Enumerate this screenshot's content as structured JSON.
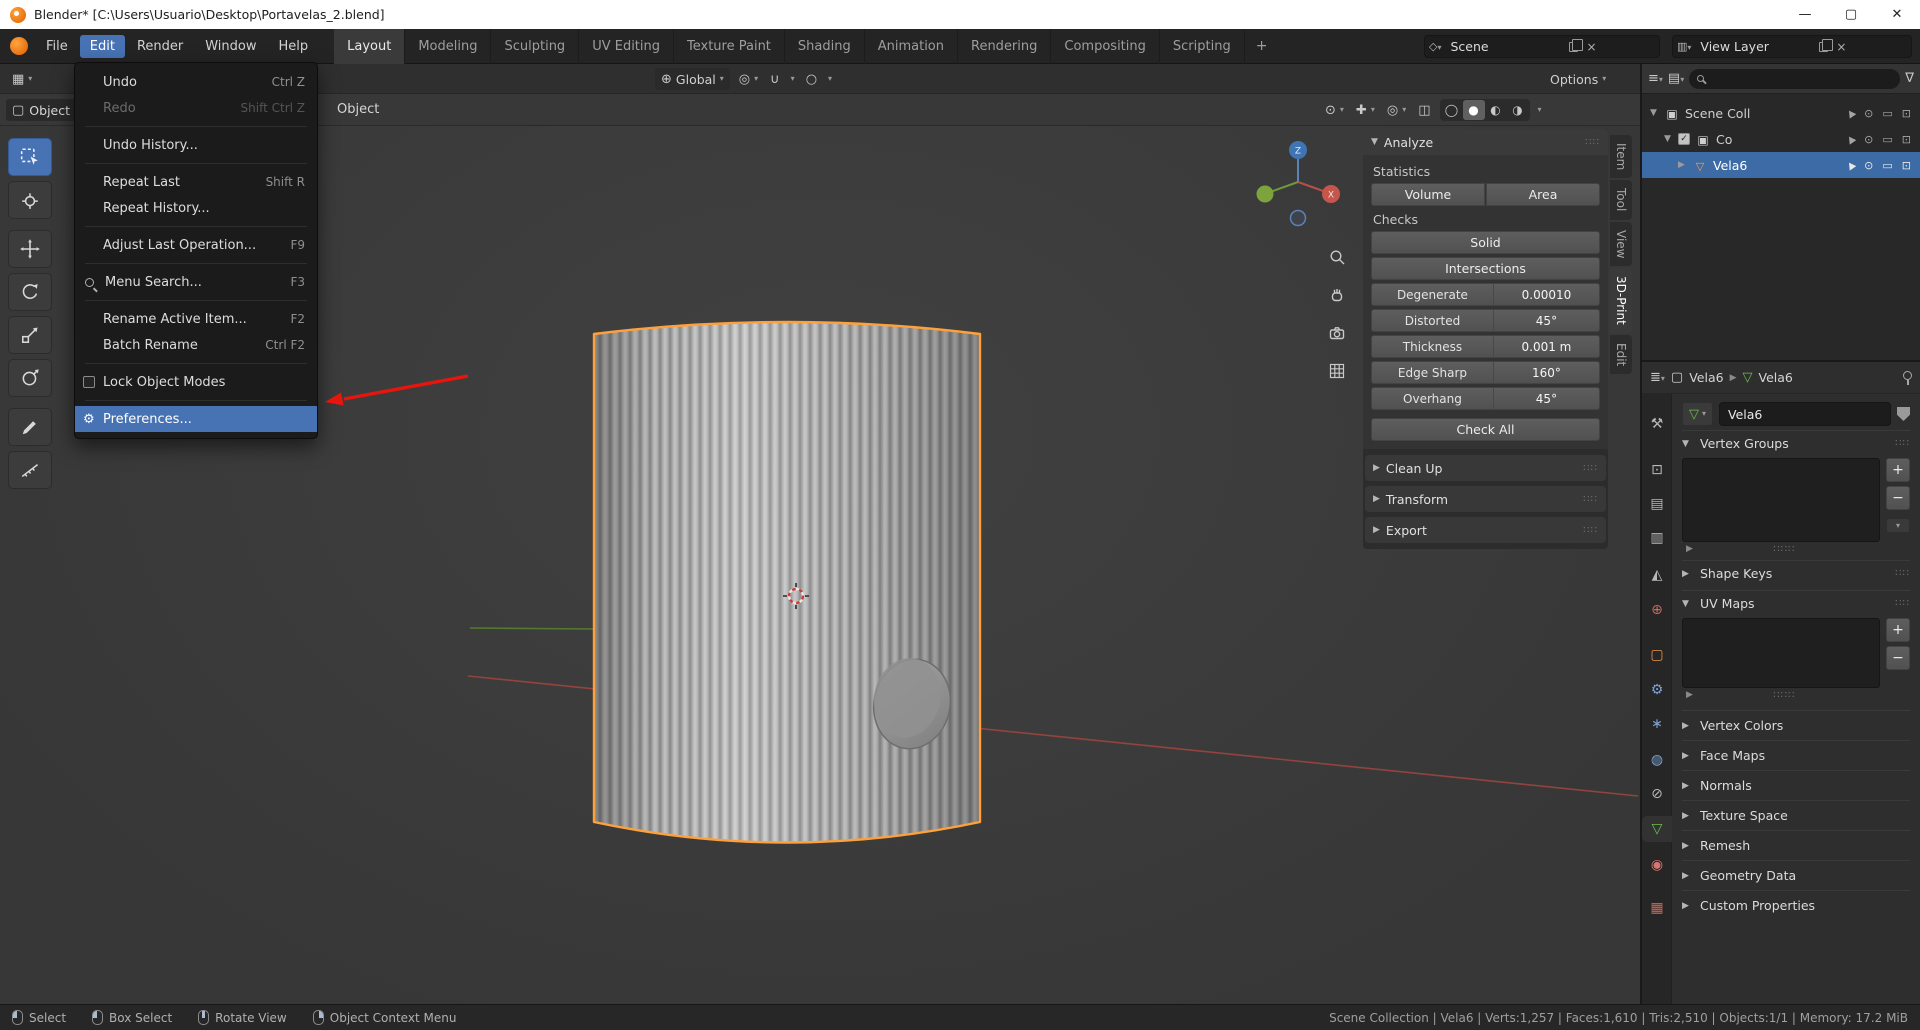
{
  "titlebar": {
    "title": "Blender* [C:\\Users\\Usuario\\Desktop\\Portavelas_2.blend]"
  },
  "topbar": {
    "menus": [
      {
        "label": "File"
      },
      {
        "label": "Edit",
        "cls": "active"
      },
      {
        "label": "Render"
      },
      {
        "label": "Window"
      },
      {
        "label": "Help"
      }
    ],
    "workspaces": [
      {
        "label": "Layout",
        "cls": "active"
      },
      {
        "label": "Modeling"
      },
      {
        "label": "Sculpting"
      },
      {
        "label": "UV Editing"
      },
      {
        "label": "Texture Paint"
      },
      {
        "label": "Shading"
      },
      {
        "label": "Animation"
      },
      {
        "label": "Rendering"
      },
      {
        "label": "Compositing"
      },
      {
        "label": "Scripting"
      }
    ],
    "add_workspace_label": "+",
    "scene_selector": {
      "value": "Scene"
    },
    "view_layer_selector": {
      "value": "View Layer"
    }
  },
  "edit_menu": {
    "items": [
      {
        "label": "Undo",
        "shortcut": "Ctrl Z"
      },
      {
        "label": "Redo",
        "shortcut": "Shift Ctrl Z",
        "cls": "disabled"
      },
      {
        "cls": "sep"
      },
      {
        "label": "Undo History..."
      },
      {
        "cls": "sep"
      },
      {
        "label": "Repeat Last",
        "shortcut": "Shift R"
      },
      {
        "label": "Repeat History..."
      },
      {
        "cls": "sep"
      },
      {
        "label": "Adjust Last Operation...",
        "shortcut": "F9"
      },
      {
        "cls": "sep"
      },
      {
        "label": "Menu Search...",
        "shortcut": "F3",
        "icon": "search"
      },
      {
        "cls": "sep"
      },
      {
        "label": "Rename Active Item...",
        "shortcut": "F2"
      },
      {
        "label": "Batch Rename",
        "shortcut": "Ctrl F2"
      },
      {
        "cls": "sep"
      },
      {
        "label": "Lock Object Modes",
        "icon": "checkbox"
      },
      {
        "cls": "sep"
      },
      {
        "label": "Preferences...",
        "icon": "gear",
        "cls": "highlighted"
      }
    ]
  },
  "viewport": {
    "mode_label": "Object Mode",
    "object_menu_label": "Object",
    "orientation": "Global",
    "options_label": "Options",
    "gizmo": {
      "z": "Z",
      "x": "X"
    }
  },
  "analyze": {
    "title": "Analyze",
    "statistics": "Statistics",
    "volume": "Volume",
    "area": "Area",
    "checks": "Checks",
    "solid": "Solid",
    "intersections": "Intersections",
    "fields": [
      {
        "label": "Degenerate",
        "value": "0.00010"
      },
      {
        "label": "Distorted",
        "value": "45°"
      },
      {
        "label": "Thickness",
        "value": "0.001 m"
      },
      {
        "label": "Edge Sharp",
        "value": "160°"
      },
      {
        "label": "Overhang",
        "value": "45°"
      }
    ],
    "check_all": "Check All",
    "collapsed": [
      {
        "label": "Clean Up"
      },
      {
        "label": "Transform"
      },
      {
        "label": "Export"
      }
    ]
  },
  "sidebar_tabs": [
    {
      "label": "Item"
    },
    {
      "label": "Tool"
    },
    {
      "label": "View"
    },
    {
      "label": "3D-Print",
      "cls": "active"
    },
    {
      "label": "Edit"
    }
  ],
  "outliner": {
    "rows": [
      {
        "label": "Scene Coll",
        "cls": "ind0",
        "icon": "collection",
        "expander": "▼"
      },
      {
        "label": "Co",
        "cls": "ind1",
        "icon": "collection",
        "expander": "▼",
        "check": "on"
      },
      {
        "label": "Vela6",
        "cls": "ind2 selected",
        "icon": "mesh",
        "expander": "▶"
      }
    ]
  },
  "properties": {
    "breadcrumb_object": "Vela6",
    "breadcrumb_data": "Vela6",
    "name_value": "Vela6",
    "vertex_groups": "Vertex Groups",
    "shape_keys": "Shape Keys",
    "uv_maps": "UV Maps",
    "collapsed": [
      {
        "label": "Vertex Colors"
      },
      {
        "label": "Face Maps"
      },
      {
        "label": "Normals"
      },
      {
        "label": "Texture Space"
      },
      {
        "label": "Remesh"
      },
      {
        "label": "Geometry Data"
      },
      {
        "label": "Custom Properties"
      }
    ]
  },
  "statusbar": {
    "hints": [
      {
        "label": "Select",
        "icon": "lmb"
      },
      {
        "label": "Box Select",
        "icon": "lmb"
      },
      {
        "label": "Rotate View",
        "icon": "mmb"
      },
      {
        "label": "Object Context Menu",
        "icon": "rmb"
      }
    ],
    "stats": "Scene Collection | Vela6 | Verts:1,257 | Faces:1,610 | Tris:2,510 | Objects:1/1 | Memory: 17.2 MiB"
  }
}
